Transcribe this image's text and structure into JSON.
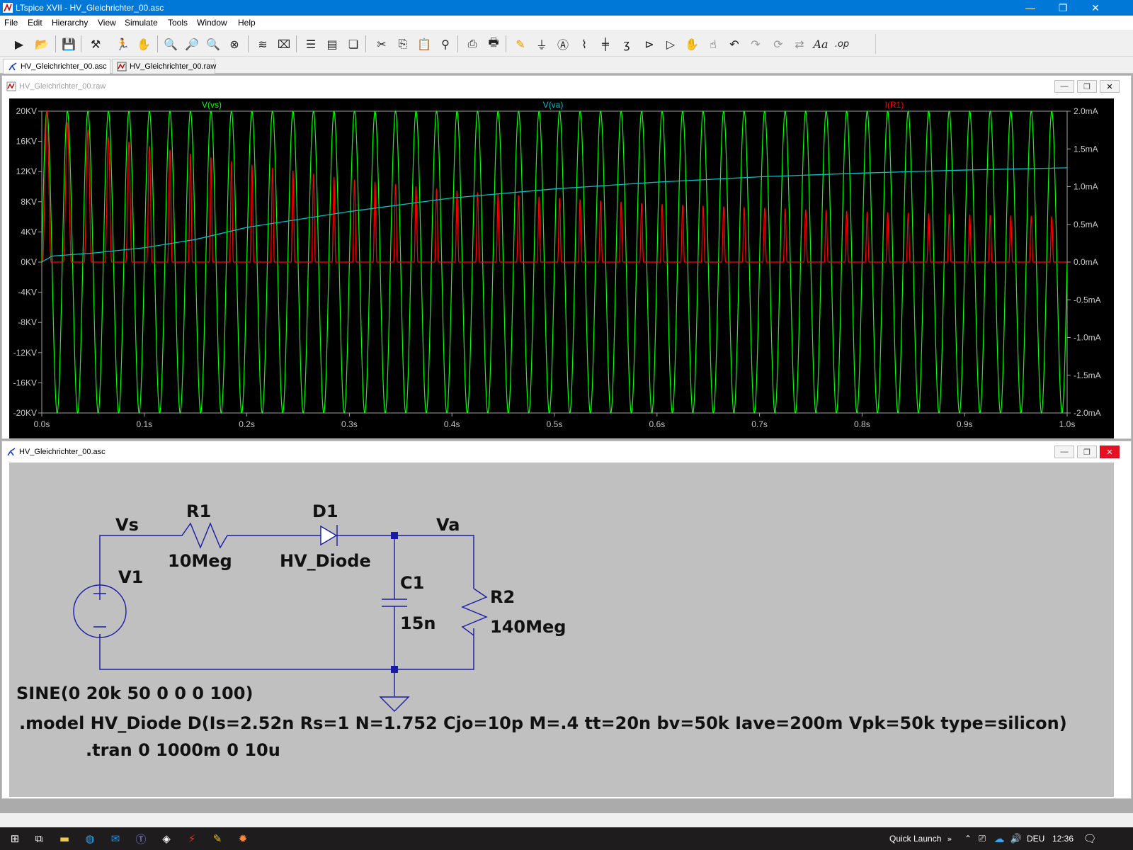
{
  "window": {
    "title": "LTspice XVII - HV_Gleichrichter_00.asc",
    "min_glyph": "—",
    "max_glyph": "❐",
    "close_glyph": "✕"
  },
  "menu": [
    "File",
    "Edit",
    "Hierarchy",
    "View",
    "Simulate",
    "Tools",
    "Window",
    "Help"
  ],
  "toolbar": {
    "icons": [
      "run",
      "open",
      "save",
      "control-panel",
      "run-halt",
      "pan",
      "zoom-in",
      "zoom-area",
      "zoom-out",
      "zoom-fit",
      "autoscale",
      "cancel",
      "tile-horizontal",
      "tile-vertical",
      "cascade",
      "cut",
      "copy",
      "paste",
      "find",
      "print",
      "print-preview",
      "draw-wire",
      "ground",
      "label-net",
      "resistor",
      "capacitor",
      "inductor",
      "diode",
      "component",
      "move",
      "drag",
      "undo",
      "redo",
      "rotate",
      "mirror",
      "text",
      "spice-directive"
    ]
  },
  "tabs": [
    {
      "label": "HV_Gleichrichter_00.asc",
      "active": true
    },
    {
      "label": "HV_Gleichrichter_00.raw",
      "active": false
    }
  ],
  "waveform_window": {
    "title": "HV_Gleichrichter_00.raw"
  },
  "schematic_window": {
    "title": "HV_Gleichrichter_00.asc"
  },
  "chart_data": {
    "type": "line",
    "title": "",
    "traces": [
      {
        "name": "V(vs)",
        "color": "#00ff00",
        "axis": "left"
      },
      {
        "name": "V(va)",
        "color": "#00c0c0",
        "axis": "left"
      },
      {
        "name": "I(R1)",
        "color": "#ff0000",
        "axis": "right"
      }
    ],
    "x_ticks": [
      "0.0s",
      "0.1s",
      "0.2s",
      "0.3s",
      "0.4s",
      "0.5s",
      "0.6s",
      "0.7s",
      "0.8s",
      "0.9s",
      "1.0s"
    ],
    "y_left_ticks": [
      "20KV",
      "16KV",
      "12KV",
      "8KV",
      "4KV",
      "0KV",
      "-4KV",
      "-8KV",
      "-12KV",
      "-16KV",
      "-20KV"
    ],
    "y_right_ticks": [
      "2.0mA",
      "1.5mA",
      "1.0mA",
      "0.5mA",
      "0.0mA",
      "-0.5mA",
      "-1.0mA",
      "-1.5mA",
      "-2.0mA"
    ],
    "xlim": [
      0,
      1.0
    ],
    "ylim_left_kV": [
      -20,
      20
    ],
    "ylim_right_mA": [
      -2.0,
      2.0
    ],
    "vs": {
      "amplitude_kV": 20,
      "frequency_hz": 50
    },
    "va_points": {
      "x": [
        0,
        0.01,
        0.05,
        0.1,
        0.15,
        0.2,
        0.3,
        0.4,
        0.5,
        0.6,
        0.7,
        0.8,
        0.9,
        1.0
      ],
      "y": [
        0.0,
        0.8,
        1.2,
        1.9,
        3.0,
        4.6,
        6.7,
        8.5,
        9.7,
        10.6,
        11.3,
        11.8,
        12.2,
        12.5
      ]
    },
    "ir1_peaks_mA": {
      "x": [
        0.005,
        0.025,
        0.045,
        0.065,
        0.1,
        0.2,
        0.3,
        0.4,
        0.5,
        0.6,
        0.7,
        0.8,
        0.9,
        1.0
      ],
      "y": [
        2.0,
        1.85,
        1.75,
        1.65,
        1.55,
        1.3,
        1.1,
        0.95,
        0.85,
        0.77,
        0.72,
        0.67,
        0.63,
        0.6
      ]
    }
  },
  "schematic": {
    "net_vs": "Vs",
    "net_va": "Va",
    "r1_name": "R1",
    "r1_value": "10Meg",
    "d1_name": "D1",
    "d1_value": "HV_Diode",
    "v1_name": "V1",
    "c1_name": "C1",
    "c1_value": "15n",
    "r2_name": "R2",
    "r2_value": "140Meg",
    "source_spec": "SINE(0 20k 50 0 0 0 100)",
    "model_directive": ".model HV_Diode D(Is=2.52n Rs=1 N=1.752 Cjo=10p M=.4 tt=20n bv=50k Iave=200m Vpk=50k type=silicon)",
    "tran_directive": ".tran 0 1000m 0 10u"
  },
  "taskbar": {
    "quick_launch": "Quick Launch",
    "lang": "DEU",
    "time": "12:36"
  }
}
